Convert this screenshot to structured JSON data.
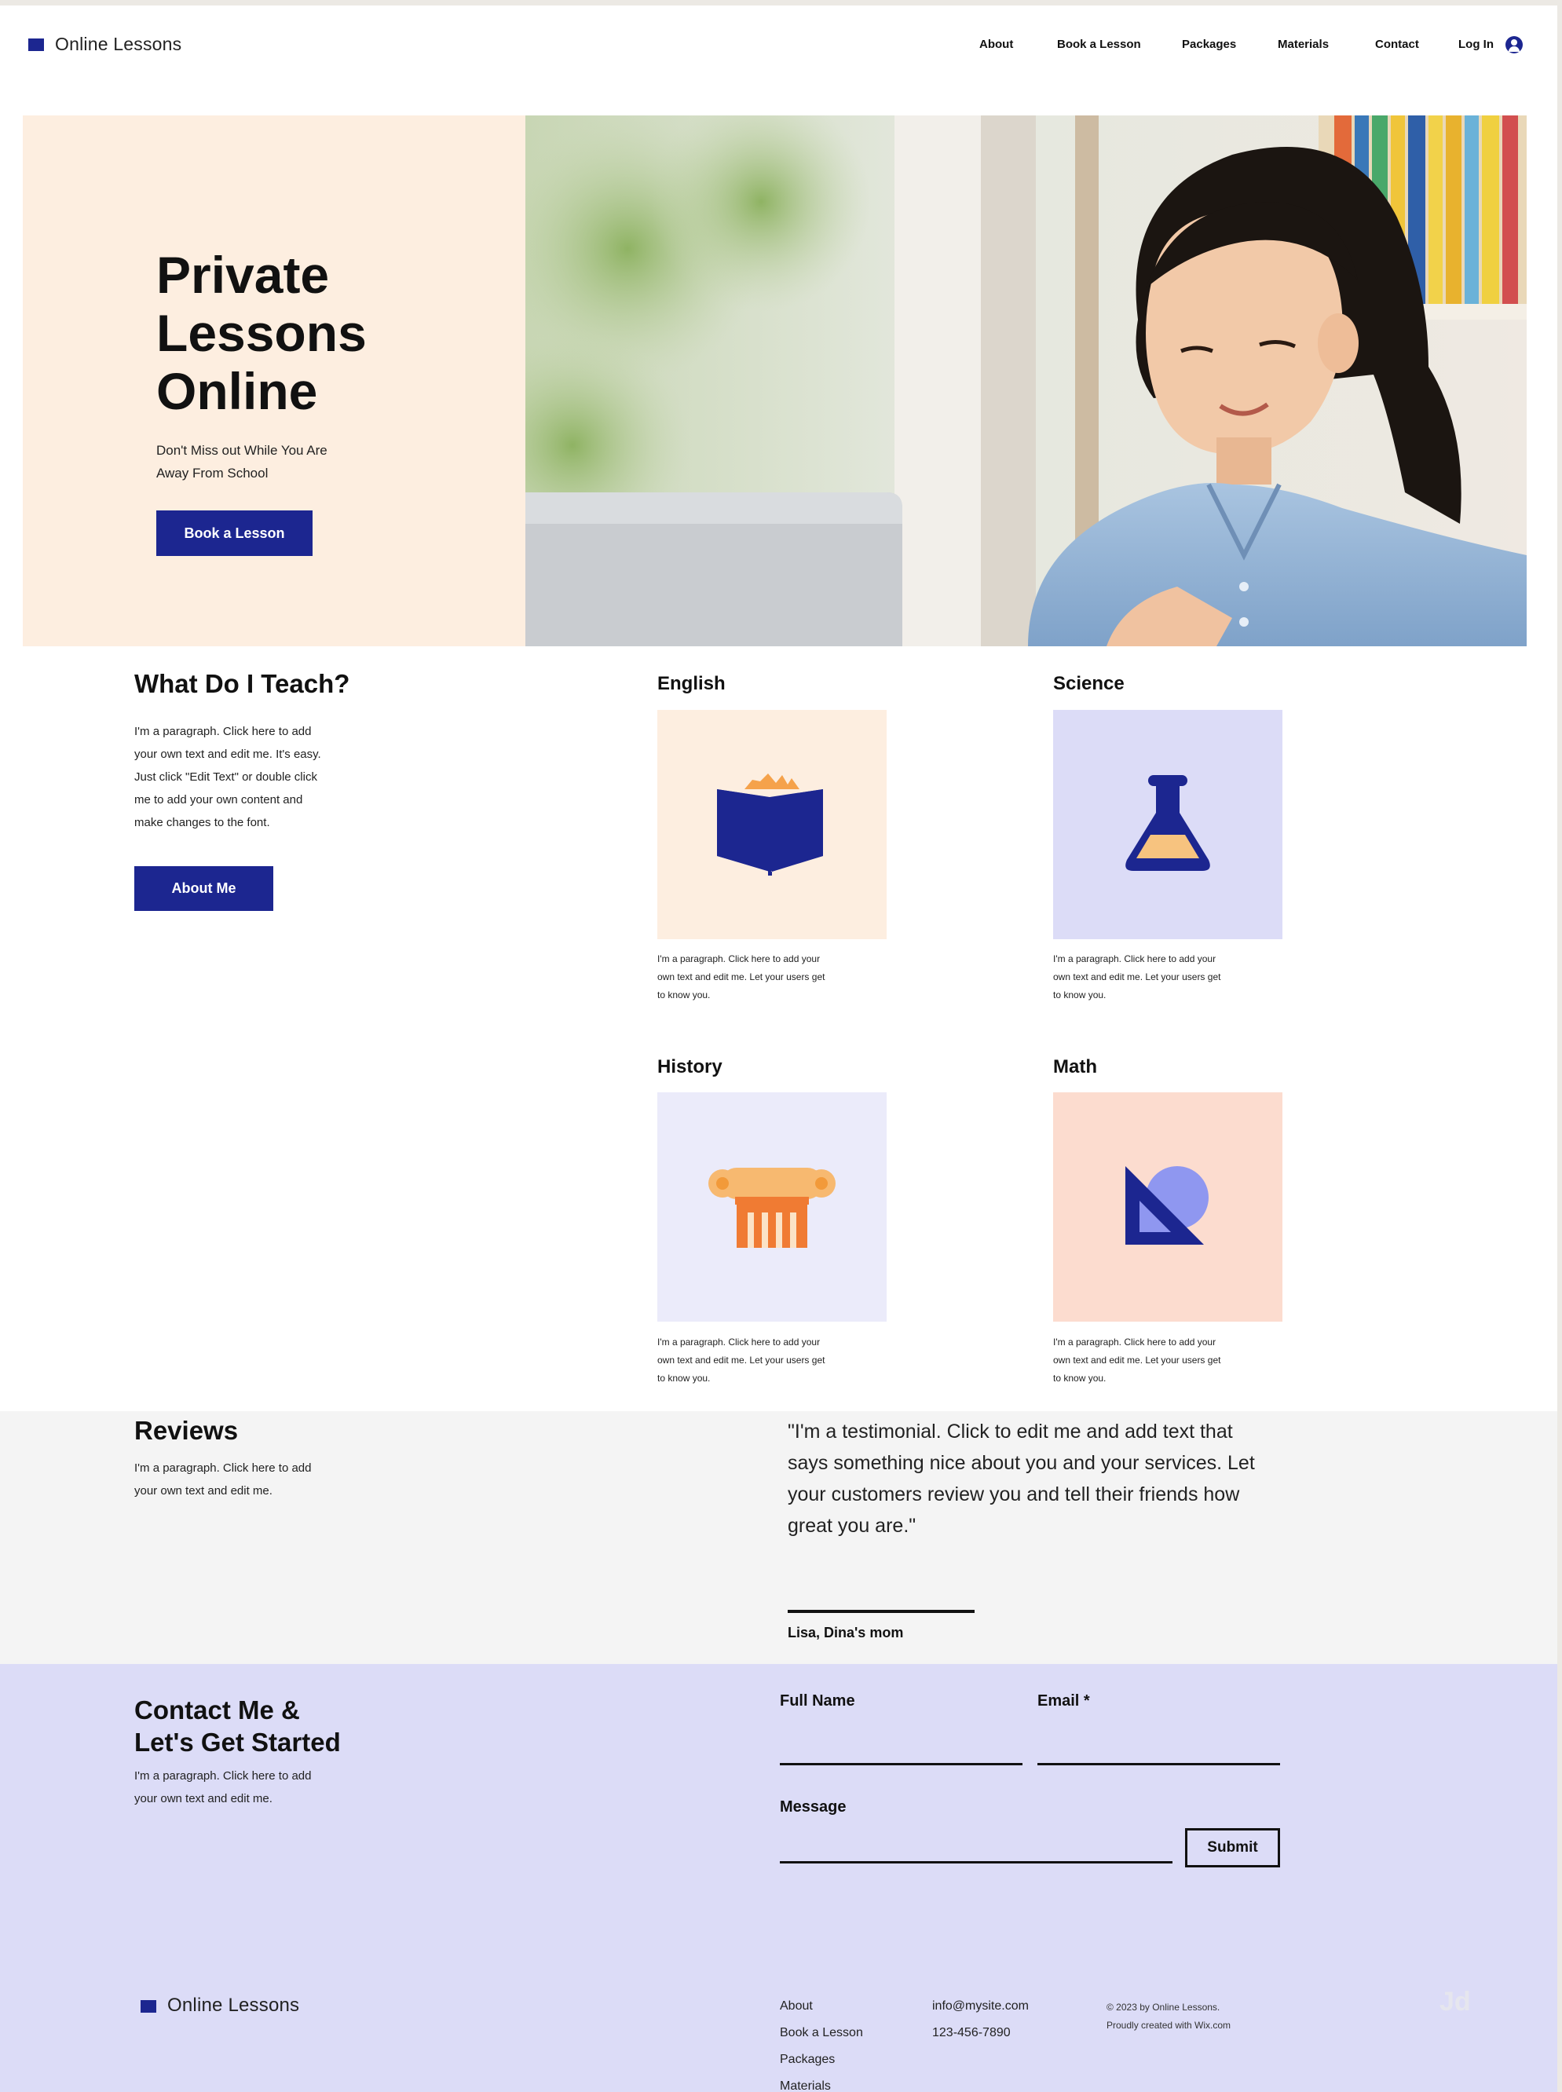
{
  "header": {
    "logo": "Online Lessons",
    "nav": [
      "About",
      "Book a Lesson",
      "Packages",
      "Materials",
      "Contact"
    ],
    "login": "Log In",
    "brand_color": "#1c2690"
  },
  "hero": {
    "title_lines": [
      "Private",
      "Lessons",
      "Online"
    ],
    "subtitle_lines": [
      "Don't Miss out While You Are",
      "Away From School"
    ],
    "cta": "Book a Lesson",
    "bg_color": "#fdeee0"
  },
  "teach": {
    "heading": "What Do I Teach?",
    "paragraph_lines": [
      "I'm a paragraph. Click here to add",
      "your own text and edit me. It's easy.",
      "Just click \"Edit Text\" or double click",
      "me to add your own content and",
      "make changes to the font."
    ],
    "button": "About Me",
    "subjects": [
      {
        "title": "English",
        "icon": "book-icon",
        "tile_color": "#fdeee0",
        "caption_lines": [
          "I'm a paragraph. Click here to add your",
          "own text and edit me. Let your users get",
          "to know you."
        ]
      },
      {
        "title": "Science",
        "icon": "flask-icon",
        "tile_color": "#dcdcf7",
        "caption_lines": [
          "I'm a paragraph. Click here to add your",
          "own text and edit me. Let your users get",
          "to know you."
        ]
      },
      {
        "title": "History",
        "icon": "column-icon",
        "tile_color": "#ebebfa",
        "caption_lines": [
          "I'm a paragraph. Click here to add your",
          "own text and edit me. Let your users get",
          "to know you."
        ]
      },
      {
        "title": "Math",
        "icon": "set-square-icon",
        "tile_color": "#fcdccf",
        "caption_lines": [
          "I'm a paragraph. Click here to add your",
          "own text and edit me. Let your users get",
          "to know you."
        ]
      }
    ]
  },
  "reviews": {
    "heading": "Reviews",
    "paragraph_lines": [
      "I'm a paragraph. Click here to add",
      "your own text and edit me."
    ],
    "quote_lines": [
      "\"I'm a testimonial. Click to edit me and add text that",
      "says something nice about you and your services. Let",
      "your customers review you and tell their friends how",
      "great you are.\""
    ],
    "author": "Lisa, Dina's mom"
  },
  "contact": {
    "heading_lines": [
      "Contact Me &",
      "Let's Get Started"
    ],
    "paragraph_lines": [
      "I'm a paragraph. Click here to add",
      "your own text and edit me."
    ],
    "fields": {
      "full_name": "Full Name",
      "email": "Email *",
      "message": "Message"
    },
    "submit": "Submit",
    "bg_color": "#dcdcf7"
  },
  "footer": {
    "logo": "Online Lessons",
    "links": [
      "About",
      "Book a Lesson",
      "Packages",
      "Materials"
    ],
    "email": "info@mysite.com",
    "phone": "123-456-7890",
    "copyright_lines": [
      "© 2023 by Online Lessons.",
      "Proudly created with Wix.com"
    ],
    "watermark": "Jd"
  }
}
